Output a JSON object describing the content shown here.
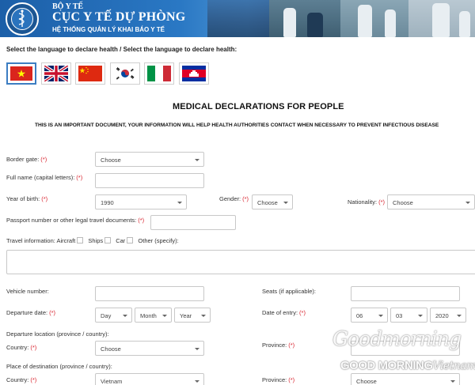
{
  "header": {
    "org_top": "BỘ Y TẾ",
    "org_name": "CỤC Y TẾ DỰ PHÒNG",
    "org_sub": "HỆ THỐNG QUẢN LÝ KHAI BÁO Y TẾ"
  },
  "language": {
    "title": "Select the language to declare health / Select the language to declare health:",
    "flags": [
      "vietnam-flag-icon",
      "united-kingdom-flag-icon",
      "china-flag-icon",
      "korea-flag-icon",
      "italy-flag-icon",
      "cambodia-flag-icon"
    ],
    "selected": "vietnam-flag-icon"
  },
  "form": {
    "title": "MEDICAL DECLARATIONS FOR PEOPLE",
    "notice": "THIS IS AN IMPORTANT DOCUMENT, YOUR INFORMATION WILL HELP HEALTH AUTHORITIES CONTACT WHEN NECESSARY TO PREVENT INFECTIOUS DISEASE",
    "required_mark": "(*)",
    "border_gate": {
      "label": "Border gate:",
      "value": "Choose"
    },
    "full_name": {
      "label": "Full name (capital letters):",
      "value": ""
    },
    "year_of_birth": {
      "label": "Year of birth:",
      "value": "1990"
    },
    "gender": {
      "label": "Gender:",
      "value": "Choose"
    },
    "nationality": {
      "label": "Nationality:",
      "value": "Choose"
    },
    "passport": {
      "label": "Passport number or other legal travel documents:",
      "value": ""
    },
    "travel_info": {
      "label": "Travel information:",
      "options": [
        "Aircraft",
        "Ships",
        "Car",
        "Other (specify):"
      ],
      "details": ""
    },
    "vehicle_number": {
      "label": "Vehicle number:",
      "value": ""
    },
    "seats": {
      "label": "Seats (if applicable):",
      "value": ""
    },
    "departure_date": {
      "label": "Departure date:",
      "day": "Day",
      "month": "Month",
      "year": "Year"
    },
    "date_of_entry": {
      "label": "Date of entry:",
      "day": "06",
      "month": "03",
      "year": "2020"
    },
    "departure_location": {
      "heading": "Departure location (province / country):",
      "country_label": "Country:",
      "country_value": "Choose",
      "province_label": "Province:",
      "province_value": ""
    },
    "destination": {
      "heading": "Place of destination (province / country):",
      "country_label": "Country:",
      "country_value": "Vietnam",
      "province_label": "Province:",
      "province_value": "Choose"
    }
  },
  "watermark": {
    "script": "Goodmorning",
    "text_main": "GOOD MORNING",
    "text_italic": "Vietnam"
  },
  "colors": {
    "required": "#d9232e",
    "banner_blue": "#2a78c4",
    "selected_flag_border": "#3c7dc2"
  }
}
